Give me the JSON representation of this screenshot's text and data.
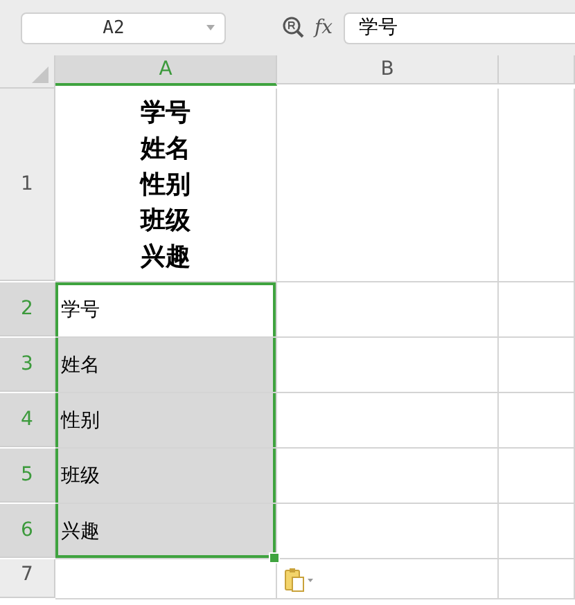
{
  "name_box": {
    "value": "A2"
  },
  "formula_bar": {
    "fx": "fx",
    "value": "学号"
  },
  "columns": [
    {
      "label": "A",
      "selected": true
    },
    {
      "label": "B",
      "selected": false
    },
    {
      "selected": false
    }
  ],
  "rows": [
    {
      "header": "1",
      "selected": false,
      "cells": [
        {
          "lines": [
            "学号",
            "姓名",
            "性别",
            "班级",
            "兴趣"
          ],
          "selected": false
        }
      ]
    },
    {
      "header": "2",
      "selected": true,
      "cells": [
        {
          "lines": [
            "学号"
          ],
          "selected": true,
          "active": true
        }
      ]
    },
    {
      "header": "3",
      "selected": true,
      "cells": [
        {
          "lines": [
            "姓名"
          ],
          "selected": true,
          "active": false
        }
      ]
    },
    {
      "header": "4",
      "selected": true,
      "cells": [
        {
          "lines": [
            "性别"
          ],
          "selected": true,
          "active": false
        }
      ]
    },
    {
      "header": "5",
      "selected": true,
      "cells": [
        {
          "lines": [
            "班级"
          ],
          "selected": true,
          "active": false
        }
      ]
    },
    {
      "header": "6",
      "selected": true,
      "cells": [
        {
          "lines": [
            "兴趣"
          ],
          "selected": true,
          "active": false
        }
      ]
    },
    {
      "header": "7",
      "selected": false,
      "cells": [
        {
          "selected": false
        }
      ]
    }
  ]
}
